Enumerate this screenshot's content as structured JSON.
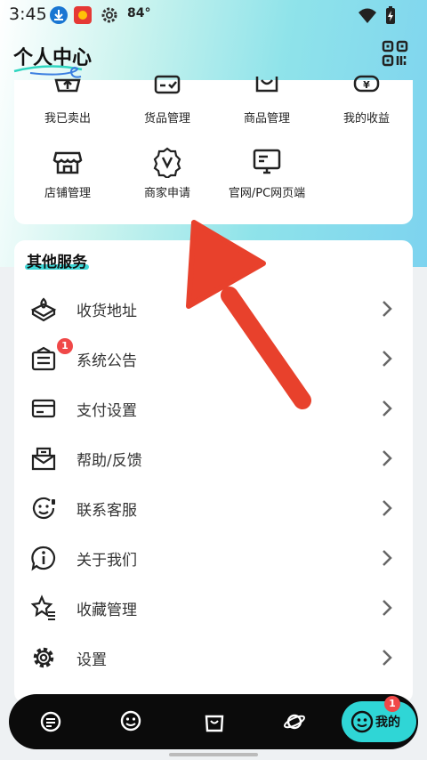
{
  "status_bar": {
    "time": "3:45",
    "temperature": "84°"
  },
  "header": {
    "title": "个人中心"
  },
  "top_grid": {
    "items": [
      {
        "label": "我已卖出",
        "icon": "cart-upload-icon"
      },
      {
        "label": "货品管理",
        "icon": "checklist-box-icon"
      },
      {
        "label": "商品管理",
        "icon": "shopping-bag-icon"
      },
      {
        "label": "我的收益",
        "icon": "yen-wallet-icon"
      },
      {
        "label": "店铺管理",
        "icon": "storefront-icon"
      },
      {
        "label": "商家申请",
        "icon": "verified-badge-icon"
      },
      {
        "label": "官网/PC网页端",
        "icon": "monitor-icon"
      }
    ]
  },
  "services": {
    "title": "其他服务",
    "items": [
      {
        "label": "收货地址",
        "icon": "map-location-icon"
      },
      {
        "label": "系统公告",
        "icon": "notice-board-icon",
        "badge": "1"
      },
      {
        "label": "支付设置",
        "icon": "credit-card-icon"
      },
      {
        "label": "帮助/反馈",
        "icon": "mail-feedback-icon"
      },
      {
        "label": "联系客服",
        "icon": "customer-service-icon"
      },
      {
        "label": "关于我们",
        "icon": "info-chat-icon"
      },
      {
        "label": "收藏管理",
        "icon": "star-list-icon"
      },
      {
        "label": "设置",
        "icon": "gear-icon"
      }
    ]
  },
  "bottom_nav": {
    "active_label": "我的",
    "active_badge": "1"
  },
  "colors": {
    "accent": "#2fd6d6",
    "badge": "#f04848",
    "arrow": "#e8412c"
  }
}
